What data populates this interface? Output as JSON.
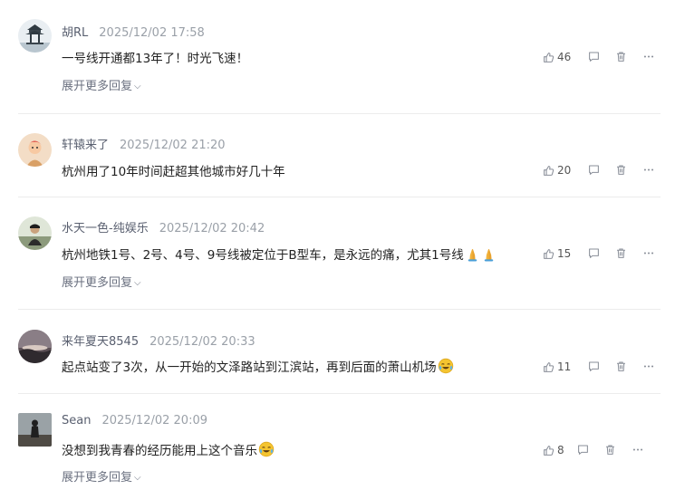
{
  "comments": [
    {
      "author": "胡RL",
      "time": "2025/12/02 17:58",
      "text": "一号线开通都13年了！时光飞速！",
      "likes": "46",
      "expand": "展开更多回复",
      "avatar_icon": "pagoda-avatar-icon"
    },
    {
      "author": "轩辕来了",
      "time": "2025/12/02 21:20",
      "text": "杭州用了10年时间赶超其他城市好几十年",
      "likes": "20",
      "avatar_icon": "cartoon-avatar-icon"
    },
    {
      "author": "水天一色-纯娱乐",
      "time": "2025/12/02 20:42",
      "text": "杭州地铁1号、2号、4号、9号线被定位于B型车，是永远的痛，尤其1号线",
      "likes": "15",
      "expand": "展开更多回复",
      "avatar_icon": "person-avatar-icon",
      "emoji": "praying-hands-icon"
    },
    {
      "author": "来年夏天8545",
      "time": "2025/12/02 20:33",
      "text": "起点站变了3次，从一开始的文泽路站到江滨站，再到后面的萧山机场",
      "likes": "11",
      "avatar_icon": "dusk-landscape-avatar-icon",
      "emoji": "crying-laughing-icon"
    },
    {
      "author": "Sean",
      "time": "2025/12/02 20:09",
      "text": "没想到我青春的经历能用上这个音乐",
      "likes": "8",
      "expand": "展开更多回复",
      "avatar_icon": "silhouette-avatar-icon",
      "emoji": "crying-laughing-icon"
    }
  ],
  "colors": {
    "author": "#5a6070",
    "time": "#9aa0a8",
    "icon": "#8a8f99",
    "divider": "#ececec"
  }
}
